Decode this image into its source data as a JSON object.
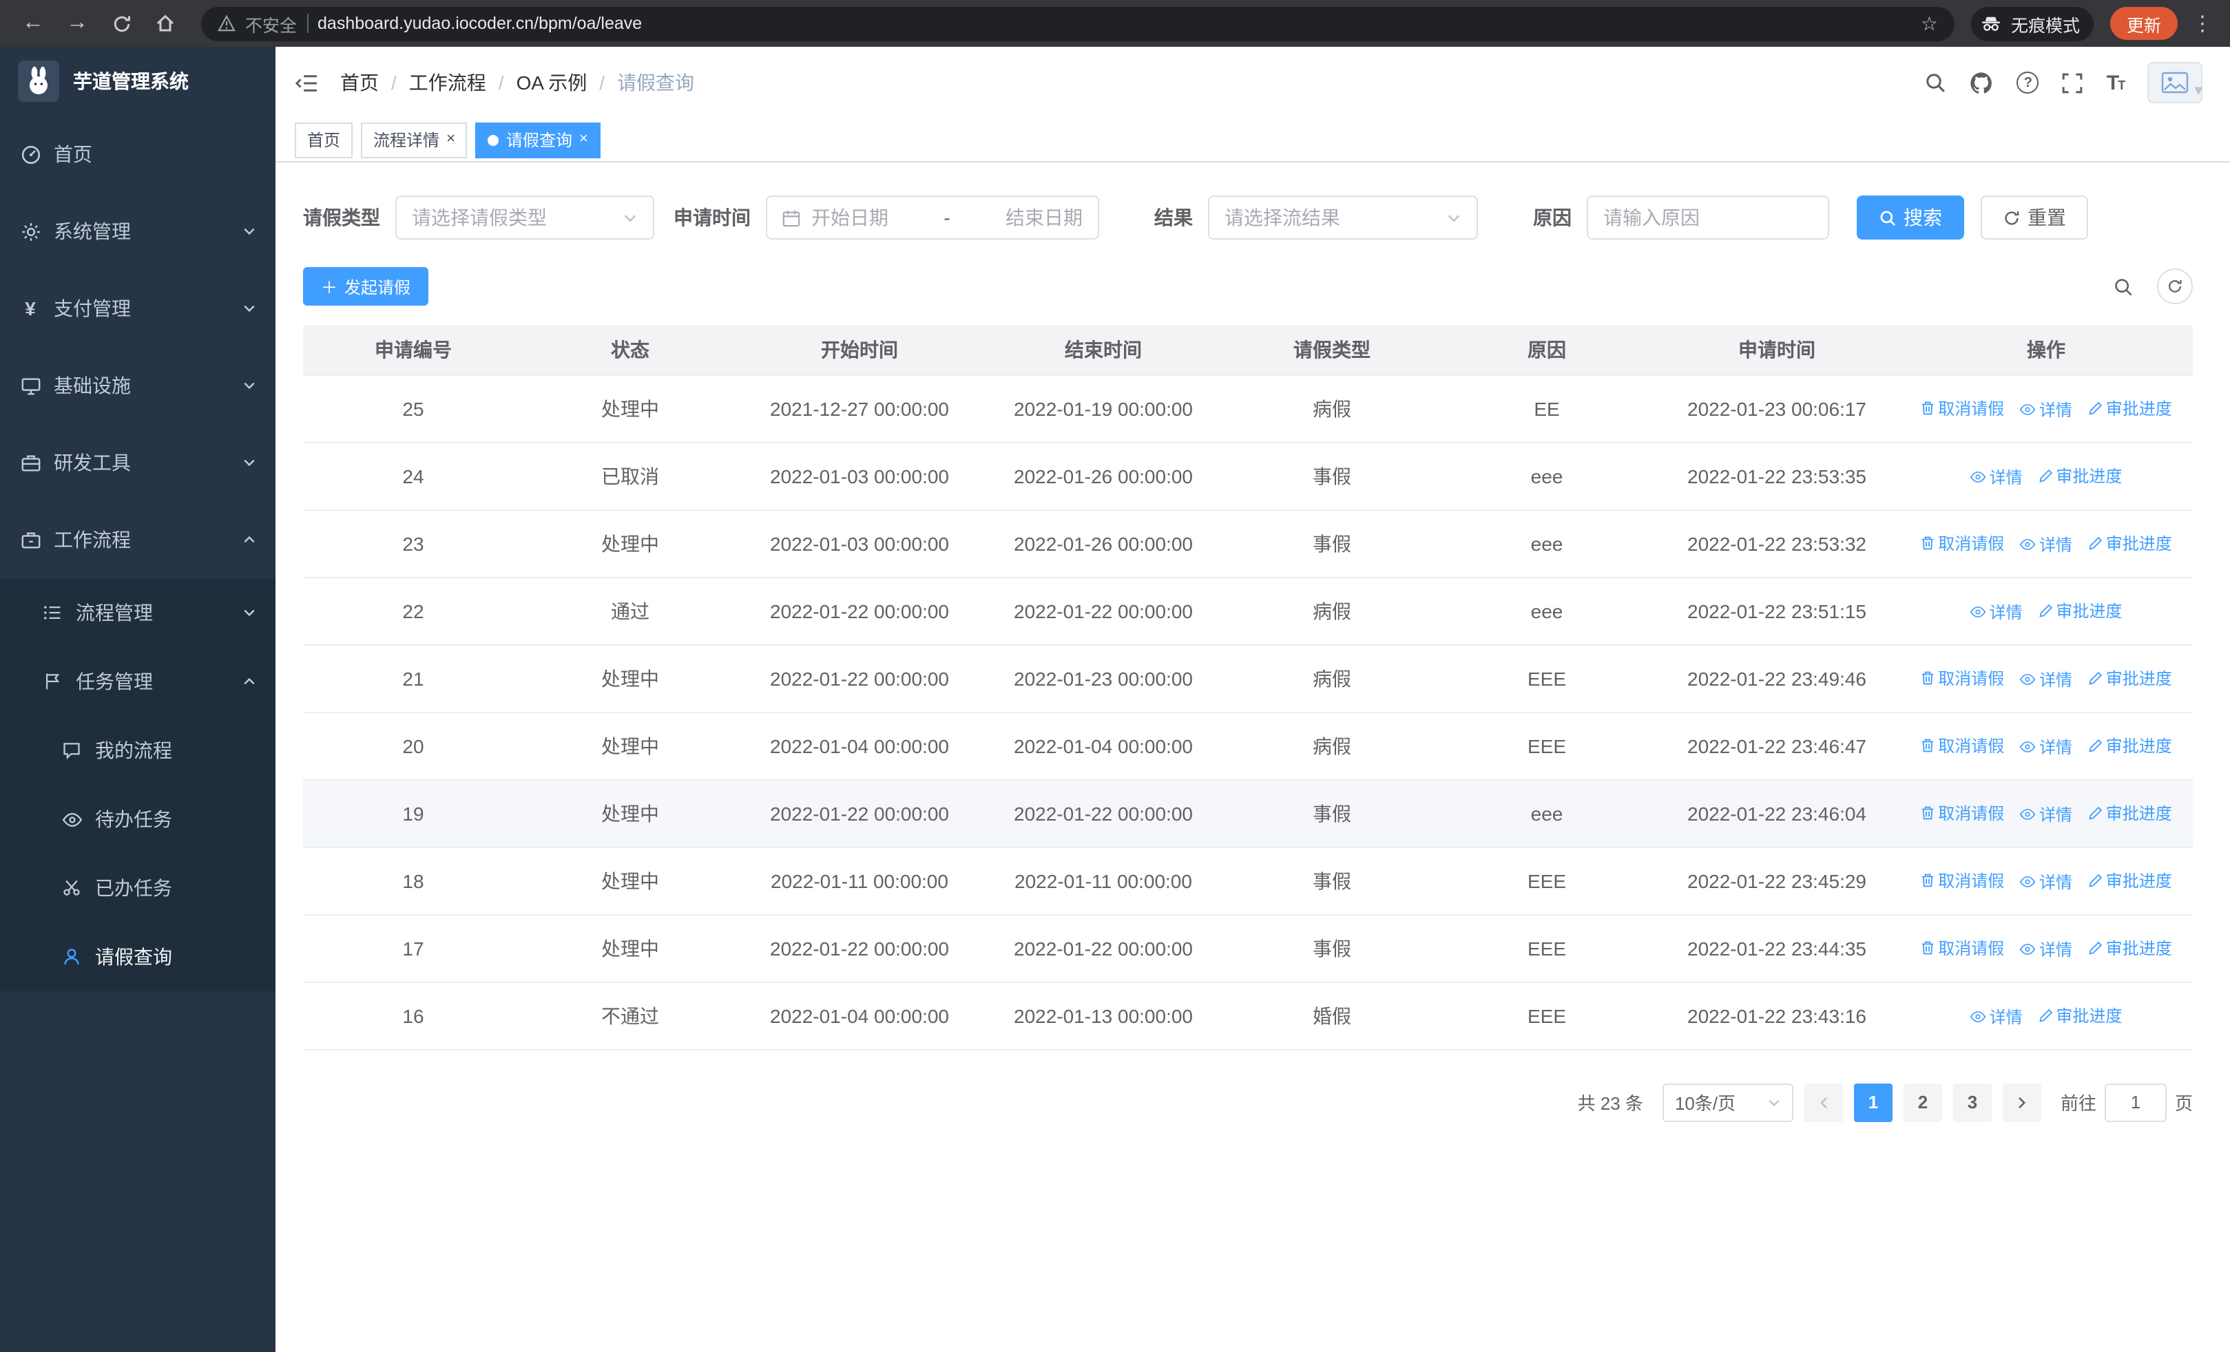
{
  "browser": {
    "security_warning": "不安全",
    "url": "dashboard.yudao.iocoder.cn/bpm/oa/leave",
    "incognito_label": "无痕模式",
    "update_label": "更新"
  },
  "sidebar": {
    "app_title": "芋道管理系统",
    "items": {
      "home": "首页",
      "system": "系统管理",
      "payment": "支付管理",
      "infra": "基础设施",
      "devtools": "研发工具",
      "workflow": "工作流程",
      "process_mgmt": "流程管理",
      "task_mgmt": "任务管理",
      "my_process": "我的流程",
      "todo_tasks": "待办任务",
      "done_tasks": "已办任务",
      "leave_query": "请假查询"
    }
  },
  "breadcrumb": [
    "首页",
    "工作流程",
    "OA 示例",
    "请假查询"
  ],
  "tabs": [
    {
      "label": "首页",
      "closable": false,
      "active": false
    },
    {
      "label": "流程详情",
      "closable": true,
      "active": false
    },
    {
      "label": "请假查询",
      "closable": true,
      "active": true
    }
  ],
  "filters": {
    "leave_type_label": "请假类型",
    "leave_type_placeholder": "请选择请假类型",
    "apply_time_label": "申请时间",
    "start_date_placeholder": "开始日期",
    "range_separator": "-",
    "end_date_placeholder": "结束日期",
    "result_label": "结果",
    "result_placeholder": "请选择流结果",
    "reason_label": "原因",
    "reason_placeholder": "请输入原因",
    "search_label": "搜索",
    "reset_label": "重置"
  },
  "toolbar": {
    "create_label": "发起请假"
  },
  "table": {
    "headers": [
      "申请编号",
      "状态",
      "开始时间",
      "结束时间",
      "请假类型",
      "原因",
      "申请时间",
      "操作"
    ],
    "actions": {
      "cancel": "取消请假",
      "detail": "详情",
      "audit": "审批进度"
    },
    "rows": [
      {
        "id": "25",
        "status": "处理中",
        "start": "2021-12-27 00:00:00",
        "end": "2022-01-19 00:00:00",
        "type": "病假",
        "reason": "EE",
        "apply_time": "2022-01-23 00:06:17",
        "can_cancel": true,
        "highlighted": false
      },
      {
        "id": "24",
        "status": "已取消",
        "start": "2022-01-03 00:00:00",
        "end": "2022-01-26 00:00:00",
        "type": "事假",
        "reason": "eee",
        "apply_time": "2022-01-22 23:53:35",
        "can_cancel": false,
        "highlighted": false
      },
      {
        "id": "23",
        "status": "处理中",
        "start": "2022-01-03 00:00:00",
        "end": "2022-01-26 00:00:00",
        "type": "事假",
        "reason": "eee",
        "apply_time": "2022-01-22 23:53:32",
        "can_cancel": true,
        "highlighted": false
      },
      {
        "id": "22",
        "status": "通过",
        "start": "2022-01-22 00:00:00",
        "end": "2022-01-22 00:00:00",
        "type": "病假",
        "reason": "eee",
        "apply_time": "2022-01-22 23:51:15",
        "can_cancel": false,
        "highlighted": false
      },
      {
        "id": "21",
        "status": "处理中",
        "start": "2022-01-22 00:00:00",
        "end": "2022-01-23 00:00:00",
        "type": "病假",
        "reason": "EEE",
        "apply_time": "2022-01-22 23:49:46",
        "can_cancel": true,
        "highlighted": false
      },
      {
        "id": "20",
        "status": "处理中",
        "start": "2022-01-04 00:00:00",
        "end": "2022-01-04 00:00:00",
        "type": "病假",
        "reason": "EEE",
        "apply_time": "2022-01-22 23:46:47",
        "can_cancel": true,
        "highlighted": false
      },
      {
        "id": "19",
        "status": "处理中",
        "start": "2022-01-22 00:00:00",
        "end": "2022-01-22 00:00:00",
        "type": "事假",
        "reason": "eee",
        "apply_time": "2022-01-22 23:46:04",
        "can_cancel": true,
        "highlighted": true
      },
      {
        "id": "18",
        "status": "处理中",
        "start": "2022-01-11 00:00:00",
        "end": "2022-01-11 00:00:00",
        "type": "事假",
        "reason": "EEE",
        "apply_time": "2022-01-22 23:45:29",
        "can_cancel": true,
        "highlighted": false
      },
      {
        "id": "17",
        "status": "处理中",
        "start": "2022-01-22 00:00:00",
        "end": "2022-01-22 00:00:00",
        "type": "事假",
        "reason": "EEE",
        "apply_time": "2022-01-22 23:44:35",
        "can_cancel": true,
        "highlighted": false
      },
      {
        "id": "16",
        "status": "不通过",
        "start": "2022-01-04 00:00:00",
        "end": "2022-01-13 00:00:00",
        "type": "婚假",
        "reason": "EEE",
        "apply_time": "2022-01-22 23:43:16",
        "can_cancel": false,
        "highlighted": false
      }
    ]
  },
  "pagination": {
    "total_text": "共 23 条",
    "page_size": "10条/页",
    "pages": [
      "1",
      "2",
      "3"
    ],
    "active_page": "1",
    "goto_label": "前往",
    "goto_value": "1",
    "goto_unit": "页"
  },
  "colors": {
    "primary": "#409eff",
    "sidebar_bg": "#263445",
    "submenu_bg": "#1f2d3d"
  }
}
